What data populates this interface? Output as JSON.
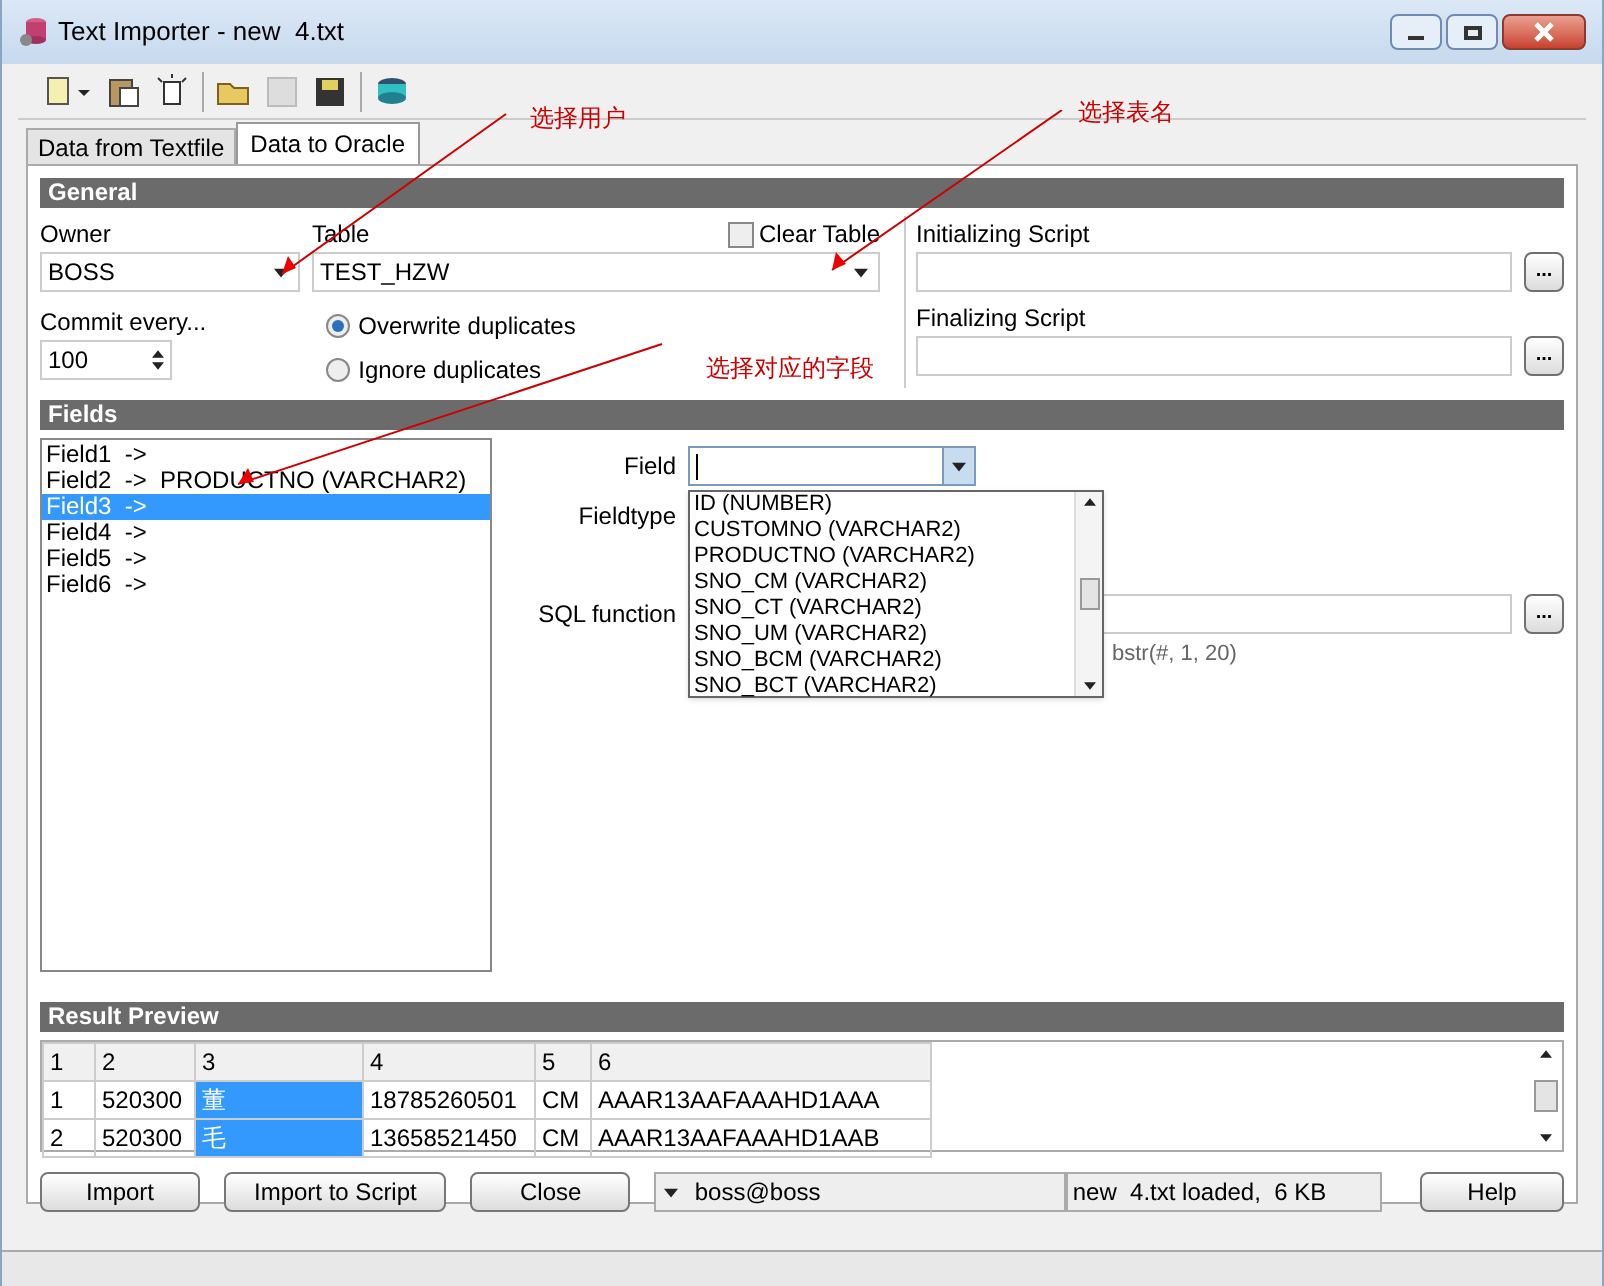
{
  "window": {
    "title": "Text Importer - new  4.txt"
  },
  "tabs": [
    {
      "label": "Data from Textfile",
      "selected": false
    },
    {
      "label": "Data to Oracle",
      "selected": true
    }
  ],
  "general": {
    "title": "General",
    "owner": {
      "label": "Owner",
      "value": "BOSS"
    },
    "table": {
      "label": "Table",
      "value": "TEST_HZW"
    },
    "clear_table": {
      "label": "Clear Table",
      "checked": false
    },
    "commit": {
      "label": "Commit every...",
      "value": "100"
    },
    "duplicates": [
      {
        "label": "Overwrite duplicates",
        "selected": true
      },
      {
        "label": "Ignore duplicates",
        "selected": false
      }
    ],
    "init_script": {
      "label": "Initializing Script",
      "button": "..."
    },
    "final_script": {
      "label": "Finalizing Script",
      "button": "..."
    }
  },
  "fields": {
    "title": "Fields",
    "items": [
      {
        "label": "Field1  ->",
        "selected": false
      },
      {
        "label": "Field2  ->  PRODUCTNO (VARCHAR2)",
        "selected": false
      },
      {
        "label": "Field3  ->",
        "selected": true
      },
      {
        "label": "Field4  ->",
        "selected": false
      },
      {
        "label": "Field5  ->",
        "selected": false
      },
      {
        "label": "Field6  ->",
        "selected": false
      }
    ],
    "field_label": "Field",
    "fieldtype_label": "Fieldtype",
    "sql_function_label": "SQL function",
    "sql_button": "...",
    "sql_hint": "bstr(#, 1, 20)",
    "dropdown_options": [
      "ID (NUMBER)",
      "CUSTOMNO (VARCHAR2)",
      "PRODUCTNO (VARCHAR2)",
      "SNO_CM (VARCHAR2)",
      "SNO_CT (VARCHAR2)",
      "SNO_UM (VARCHAR2)",
      "SNO_BCM (VARCHAR2)",
      "SNO_BCT (VARCHAR2)"
    ]
  },
  "result_preview": {
    "title": "Result Preview",
    "columns": [
      "1",
      "2",
      "3",
      "4",
      "5",
      "6"
    ],
    "rows": [
      [
        "1",
        "520300",
        "董",
        "18785260501",
        "CM",
        "AAAR13AAFAAAHD1AAA"
      ],
      [
        "2",
        "520300",
        "毛",
        "13658521450",
        "CM",
        "AAAR13AAFAAAHD1AAB"
      ]
    ]
  },
  "buttons": [
    "Import",
    "Import to Script",
    "Close"
  ],
  "connection": "boss@boss",
  "file_info": "new  4.txt loaded,  6 KB",
  "help_button": "Help",
  "annotations": [
    "选择用户",
    "选择表名",
    "选择对应的字段"
  ]
}
